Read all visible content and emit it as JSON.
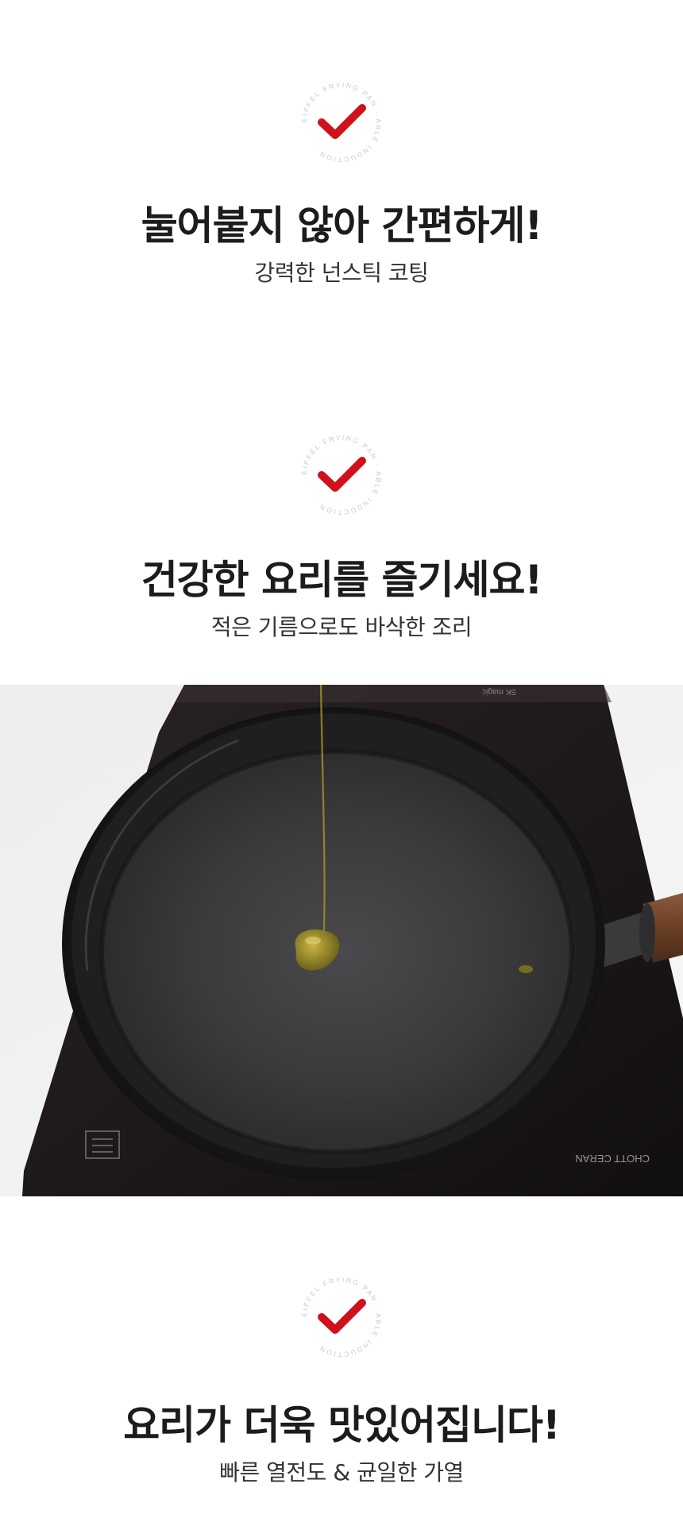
{
  "badge": {
    "ring_text": "EIFFEL FRYING PAN · ABLE INDUCTION ·",
    "check_color": "#d0101b"
  },
  "sections": [
    {
      "headline": "눌어붙지 않아 간편하게!",
      "subline": "강력한 넌스틱 코팅"
    },
    {
      "headline": "건강한 요리를 즐기세요!",
      "subline": "적은 기름으로도 바삭한 조리"
    },
    {
      "headline": "요리가 더욱 맛있어집니다!",
      "subline": "빠른 열전도 & 균일한 가열"
    }
  ],
  "photo": {
    "stove_brand": "SK magic",
    "cooktop_label": "CHOTT CERAN"
  }
}
